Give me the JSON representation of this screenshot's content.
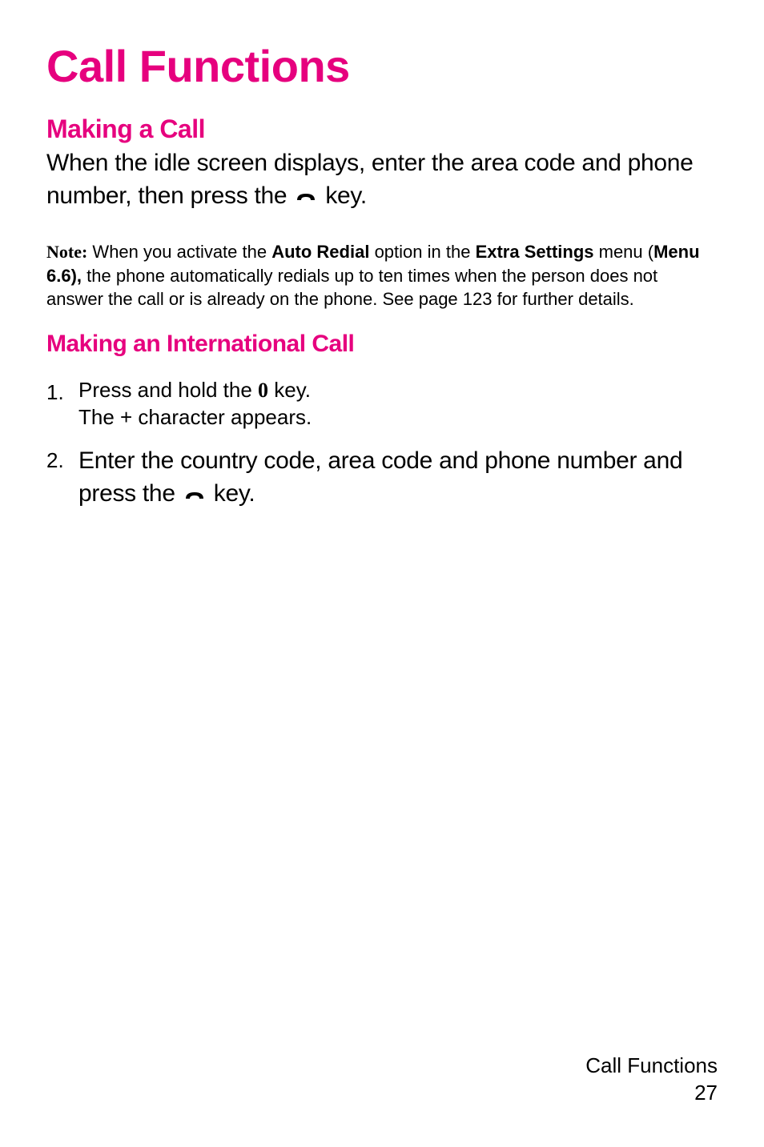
{
  "title": "Call Functions",
  "sections": {
    "making_call": {
      "heading": "Making a Call",
      "body_before": "When the idle screen displays, enter the area code and phone number, then press the ",
      "body_after": " key."
    },
    "note": {
      "label": "Note:",
      "part1": " When you activate the ",
      "bold1": "Auto Redial",
      "part2": " option in the ",
      "bold2": "Extra Settings",
      "part3": " menu (",
      "bold3": "Menu 6.6),",
      "part4": " the phone automatically redials up to ten times when the person does not answer the call or is already on the phone. See page 123 for further details."
    },
    "international": {
      "heading": "Making an International Call",
      "items": [
        {
          "number": "1.",
          "line1_before": "Press and hold the ",
          "line1_key": "0",
          "line1_after": " key.",
          "line2": "The + character appears."
        },
        {
          "number": "2.",
          "body_before": "Enter the country code, area code and phone number and press the ",
          "body_after": " key."
        }
      ]
    }
  },
  "footer": {
    "label": "Call Functions",
    "page": "27"
  }
}
